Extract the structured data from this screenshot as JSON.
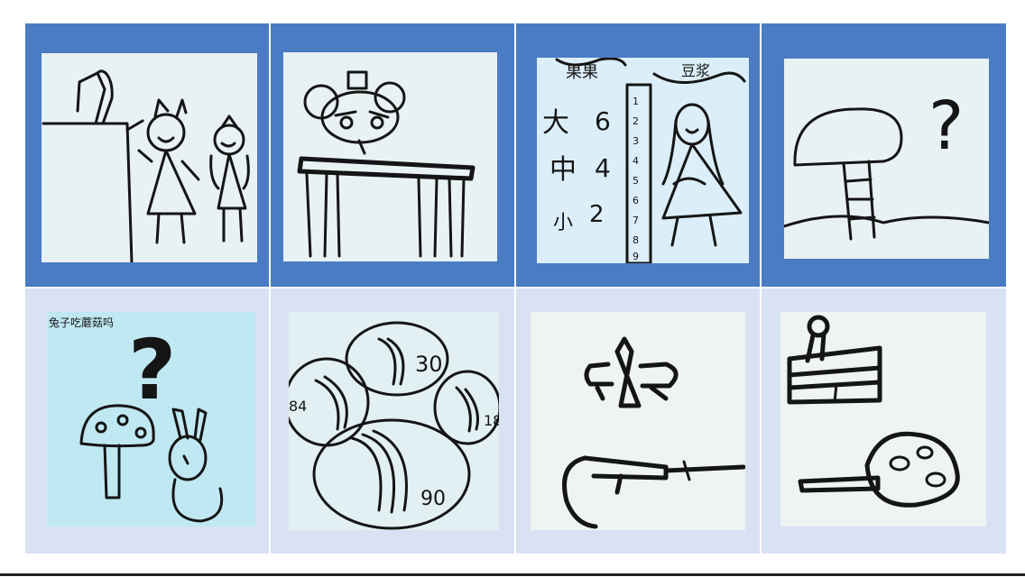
{
  "panels": [
    {
      "row": 0,
      "background": "#4a7cc4",
      "paper": "#e8f1f3"
    },
    {
      "row": 0,
      "background": "#4a7cc4",
      "paper": "#e8f1f3"
    },
    {
      "row": 0,
      "background": "#4a7cc4",
      "paper": "#dbeef9",
      "text": {
        "header_left": "果果",
        "header_right": "豆浆",
        "big": "大",
        "mid": "中",
        "small": "小",
        "n6": "6",
        "n4": "4",
        "n2": "2",
        "ruler": [
          "1",
          "2",
          "3",
          "4",
          "5",
          "6",
          "7",
          "8",
          "9"
        ]
      }
    },
    {
      "row": 0,
      "background": "#4a7cc4",
      "paper": "#e8f1f3",
      "text": {
        "question": "?"
      }
    },
    {
      "row": 1,
      "background": "#d9e2f3",
      "paper": "#bfe8f2",
      "text": {
        "caption": "兔子吃蘑菇吗",
        "question": "?"
      }
    },
    {
      "row": 1,
      "background": "#d9e2f3",
      "paper": "#e3f0f3",
      "text": {
        "n30": "30",
        "n84": "84",
        "n18": "18",
        "n90": "90"
      }
    },
    {
      "row": 1,
      "background": "#d9e2f3",
      "paper": "#eef3f3"
    },
    {
      "row": 1,
      "background": "#d9e2f3",
      "paper": "#eef3f3"
    }
  ]
}
